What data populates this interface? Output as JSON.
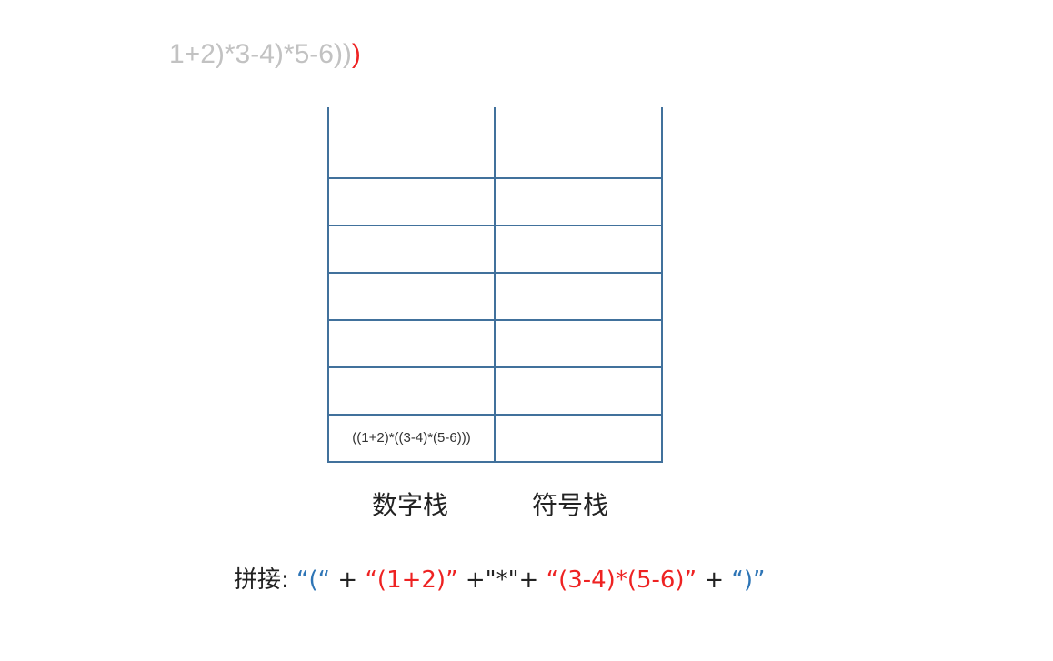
{
  "expression": {
    "processed": "1+2)*3-4)*5-6))",
    "current": ")"
  },
  "stacks": {
    "number_stack_bottom": "((1+2)*((3-4)*(5-6)))",
    "number_stack_label": "数字栈",
    "symbol_stack_label": "符号栈"
  },
  "concat": {
    "prefix": "拼接:",
    "p1": "“(“",
    "op1": "+",
    "p2": "“(1+2)”",
    "op2": "+\"*\"+",
    "p3": "“(3-4)*(5-6)”",
    "op3": "+",
    "p4": "“)”"
  },
  "colors": {
    "grid_line": "#41719c",
    "processed_text": "#c2c2c2",
    "highlight_red": "#ee2222",
    "quote_blue": "#2e75b6"
  }
}
